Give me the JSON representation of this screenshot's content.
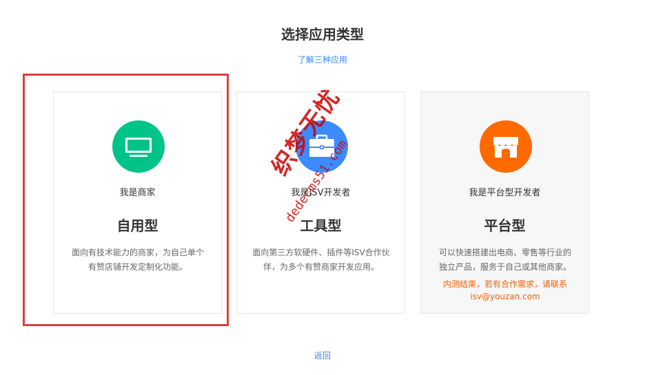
{
  "page": {
    "title": "选择应用类型",
    "learn_link": "了解三种应用",
    "back_link": "返回"
  },
  "cards": [
    {
      "subtitle": "我是商家",
      "title": "自用型",
      "description": "面向有技术能力的商家，为自己单个有赞店铺开发定制化功能。",
      "icon": "monitor-icon",
      "icon_color": "#00c389"
    },
    {
      "subtitle": "我是ISV开发者",
      "title": "工具型",
      "description": "面向第三方软硬件、插件等ISV合作伙伴，为多个有赞商家开发应用。",
      "icon": "briefcase-icon",
      "icon_color": "#3b8bff"
    },
    {
      "subtitle": "我是平台型开发者",
      "title": "平台型",
      "description": "可以快速搭建出电商、零售等行业的独立产品，服务于自己或其他商家。",
      "notice": "内测结束，若有合作需求，请联系 isv@youzan.com",
      "icon": "storefront-icon",
      "icon_color": "#ff6a00"
    }
  ],
  "watermark": {
    "text_cn": "织梦无忧",
    "text_en": "dedecms51.com"
  },
  "colors": {
    "link": "#3388ff",
    "highlight_border": "#e03c3c",
    "notice": "#f06000"
  }
}
